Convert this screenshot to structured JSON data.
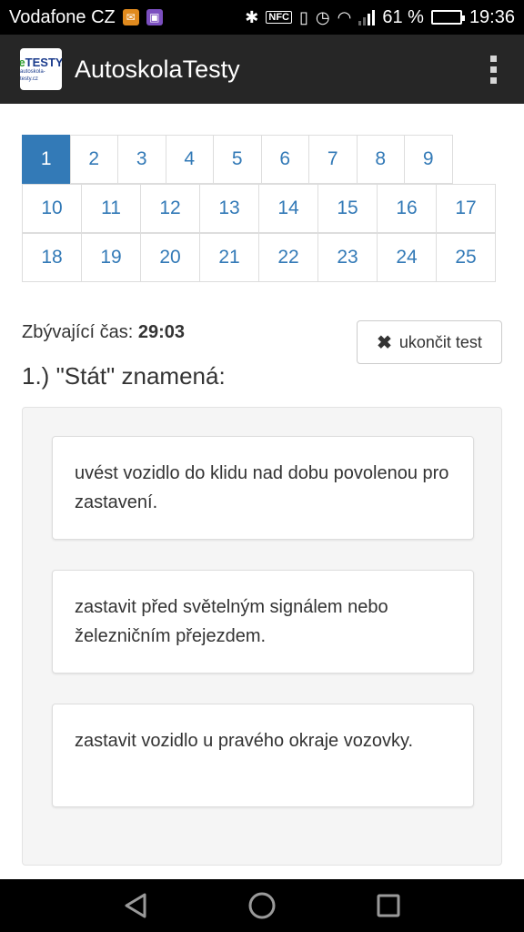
{
  "status_bar": {
    "carrier": "Vodafone CZ",
    "battery_percent": "61 %",
    "battery_level": 0.61,
    "time": "19:36"
  },
  "app_bar": {
    "title": "AutoskolaTesty",
    "logo_line1_e": "e",
    "logo_line1": "TESTY",
    "logo_line2": "autoskola-testy.cz"
  },
  "pagination": {
    "active": "1",
    "row1": [
      "1",
      "2",
      "3",
      "4",
      "5",
      "6",
      "7",
      "8",
      "9"
    ],
    "row2": [
      "10",
      "11",
      "12",
      "13",
      "14",
      "15",
      "16",
      "17"
    ],
    "row3": [
      "18",
      "19",
      "20",
      "21",
      "22",
      "23",
      "24",
      "25"
    ]
  },
  "timer": {
    "label": "Zbývající čas:",
    "value": "29:03"
  },
  "end_button": {
    "icon": "✖",
    "label": "ukončit test"
  },
  "question": {
    "text": "1.) \"Stát\" znamená:"
  },
  "answers": [
    "uvést vozidlo do klidu nad dobu povolenou pro zastavení.",
    "zastavit před světelným signálem nebo železničním přejezdem.",
    "zastavit vozidlo u pravého okraje vozovky."
  ],
  "colors": {
    "accent": "#337ab7",
    "app_bar": "#262626"
  }
}
